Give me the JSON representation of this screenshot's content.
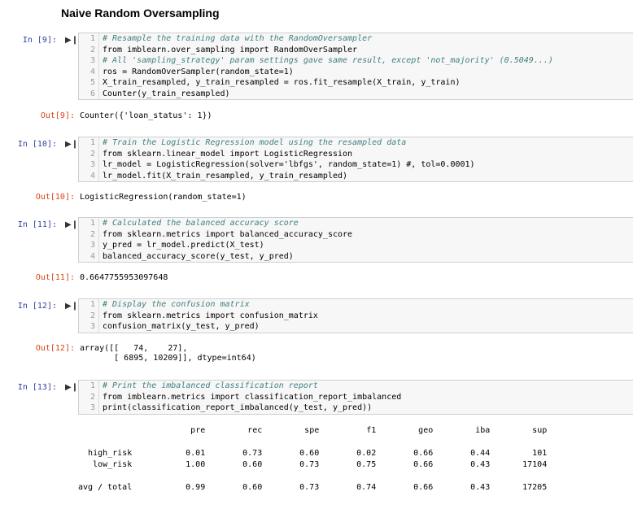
{
  "heading": "Naive Random Oversampling",
  "cells": [
    {
      "in_prompt": "In [9]:",
      "out_prompt": "Out[9]:",
      "lines": [
        "# Resample the training data with the RandomOversampler",
        "from imblearn.over_sampling import RandomOverSampler",
        "# All 'sampling_strategy' param settings gave same result, except 'not_majority' (0.5049...)",
        "ros = RandomOverSampler(random_state=1)",
        "X_train_resampled, y_train_resampled = ros.fit_resample(X_train, y_train)",
        "Counter(y_train_resampled)"
      ],
      "output": "Counter({'loan_status': 1})"
    },
    {
      "in_prompt": "In [10]:",
      "out_prompt": "Out[10]:",
      "lines": [
        "# Train the Logistic Regression model using the resampled data",
        "from sklearn.linear_model import LogisticRegression",
        "lr_model = LogisticRegression(solver='lbfgs', random_state=1) #, tol=0.0001)",
        "lr_model.fit(X_train_resampled, y_train_resampled)"
      ],
      "output": "LogisticRegression(random_state=1)"
    },
    {
      "in_prompt": "In [11]:",
      "out_prompt": "Out[11]:",
      "lines": [
        "# Calculated the balanced accuracy score",
        "from sklearn.metrics import balanced_accuracy_score",
        "y_pred = lr_model.predict(X_test)",
        "balanced_accuracy_score(y_test, y_pred)"
      ],
      "output": "0.6647755953097648"
    },
    {
      "in_prompt": "In [12]:",
      "out_prompt": "Out[12]:",
      "lines": [
        "# Display the confusion matrix",
        "from sklearn.metrics import confusion_matrix",
        "confusion_matrix(y_test, y_pred)"
      ],
      "output": "array([[   74,    27],\n       [ 6895, 10209]], dtype=int64)"
    },
    {
      "in_prompt": "In [13]:",
      "out_prompt": "",
      "lines": [
        "# Print the imbalanced classification report",
        "from imblearn.metrics import classification_report_imbalanced",
        "print(classification_report_imbalanced(y_test, y_pred))"
      ],
      "output": ""
    }
  ],
  "report": {
    "headers": [
      "pre",
      "rec",
      "spe",
      "f1",
      "geo",
      "iba",
      "sup"
    ],
    "rows": [
      {
        "label": "high_risk",
        "values": [
          "0.01",
          "0.73",
          "0.60",
          "0.02",
          "0.66",
          "0.44",
          "101"
        ]
      },
      {
        "label": "low_risk",
        "values": [
          "1.00",
          "0.60",
          "0.73",
          "0.75",
          "0.66",
          "0.43",
          "17104"
        ]
      },
      {
        "label": "avg / total",
        "values": [
          "0.99",
          "0.60",
          "0.73",
          "0.74",
          "0.66",
          "0.43",
          "17205"
        ]
      }
    ]
  },
  "colors": {
    "in_prompt": "#303f9f",
    "out_prompt": "#d84315",
    "keyword": "#008000",
    "comment": "#408080",
    "string": "#ba2121",
    "cell_bg": "#f7f7f7"
  },
  "icons": {
    "run": "run-cell-icon"
  }
}
